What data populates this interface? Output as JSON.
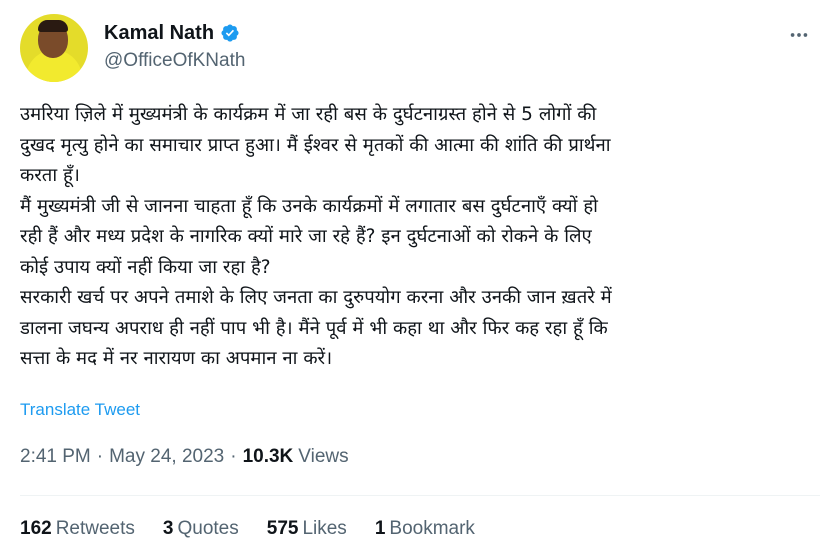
{
  "user": {
    "display_name": "Kamal Nath",
    "handle": "@OfficeOfKNath",
    "verified": true
  },
  "icons": {
    "verified": "verified-badge-icon",
    "more": "more-options-icon"
  },
  "tweet": {
    "lines": [
      "उमरिया ज़िले में मुख्यमंत्री के कार्यक्रम में जा रही बस के दुर्घटनाग्रस्त होने से 5 लोगों की",
      "दुखद मृत्यु होने का समाचार प्राप्त हुआ। मैं ईश्वर से मृतकों की आत्मा की शांति की प्रार्थना",
      "करता हूँ।",
      "मैं मुख्यमंत्री जी से जानना चाहता हूँ कि उनके कार्यक्रमों में लगातार बस दुर्घटनाएँ क्यों हो",
      "रही हैं और मध्य प्रदेश के नागरिक क्यों मारे जा रहे हैं? इन दुर्घटनाओं को रोकने के लिए",
      "कोई उपाय क्यों नहीं किया जा रहा है?",
      "सरकारी खर्च पर अपने तमाशे के लिए जनता का दुरुपयोग करना और उनकी जान ख़तरे में",
      "डालना जघन्य अपराध ही नहीं पाप भी है। मैंने पूर्व में भी कहा था और फिर कह रहा हूँ कि",
      "सत्ता के मद में नर नारायण का अपमान ना करें।"
    ],
    "translate_label": "Translate Tweet",
    "time": "2:41 PM",
    "separator": "·",
    "date": "May 24, 2023",
    "views_count": "10.3K",
    "views_label": "Views"
  },
  "stats": {
    "retweets": {
      "count": "162",
      "label": "Retweets"
    },
    "quotes": {
      "count": "3",
      "label": "Quotes"
    },
    "likes": {
      "count": "575",
      "label": "Likes"
    },
    "bookmarks": {
      "count": "1",
      "label": "Bookmark"
    }
  },
  "colors": {
    "accent": "#1d9bf0",
    "text_primary": "#0f1419",
    "text_secondary": "#536471"
  }
}
